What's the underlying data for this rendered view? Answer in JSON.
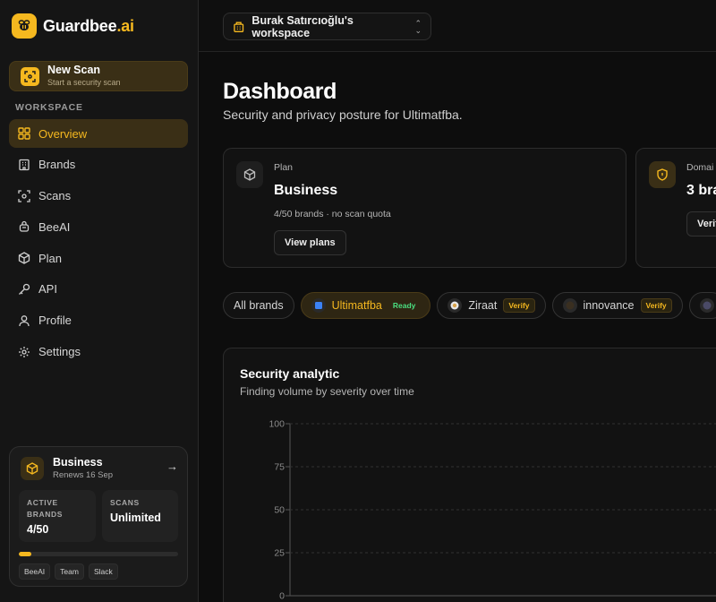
{
  "app": {
    "name_main": "Guardbee",
    "name_accent": ".ai"
  },
  "sidebar": {
    "new_scan": {
      "title": "New Scan",
      "subtitle": "Start a security scan"
    },
    "section_label": "WORKSPACE",
    "items": [
      {
        "label": "Overview",
        "icon": "grid-icon"
      },
      {
        "label": "Brands",
        "icon": "building-icon"
      },
      {
        "label": "Scans",
        "icon": "scan-icon"
      },
      {
        "label": "BeeAI",
        "icon": "bee-icon"
      },
      {
        "label": "Plan",
        "icon": "box-icon"
      },
      {
        "label": "API",
        "icon": "key-icon"
      },
      {
        "label": "Profile",
        "icon": "user-icon"
      },
      {
        "label": "Settings",
        "icon": "gear-icon"
      }
    ],
    "plan_card": {
      "title": "Business",
      "subtitle": "Renews 16 Sep",
      "stat1_label_line1": "ACTIVE",
      "stat1_label_line2": "BRANDS",
      "stat1_value": "4/50",
      "stat2_label": "SCANS",
      "stat2_value": "Unlimited",
      "usage_fraction": 0.08,
      "chips": [
        "BeeAI",
        "Team",
        "Slack"
      ]
    }
  },
  "topbar": {
    "workspace": "Burak Satırcıoğlu's workspace"
  },
  "main": {
    "title": "Dashboard",
    "subtitle": "Security and privacy posture for Ultimatfba.",
    "plan_card": {
      "label": "Plan",
      "value": "Business",
      "meta": "4/50 brands · no scan quota",
      "button": "View plans"
    },
    "domain_card": {
      "label": "Domai",
      "value": "3 bra",
      "button": "Verif"
    },
    "brand_tabs": [
      {
        "label": "All brands",
        "badge": ""
      },
      {
        "label": "Ultimatfba",
        "badge": "Ready"
      },
      {
        "label": "Ziraat",
        "badge": "Verify"
      },
      {
        "label": "innovance",
        "badge": "Verify"
      }
    ],
    "analytic": {
      "title": "Security analytic",
      "subtitle": "Finding volume by severity over time"
    }
  },
  "colors": {
    "accent": "#f5b81f",
    "ready": "#4ade80",
    "background": "#0d0d0d"
  },
  "chart_data": {
    "type": "line",
    "title": "",
    "xlabel": "",
    "ylabel": "",
    "ylim": [
      0,
      100
    ],
    "y_ticks": [
      "100",
      "75",
      "50",
      "25",
      "0"
    ],
    "grid": true,
    "series": []
  }
}
